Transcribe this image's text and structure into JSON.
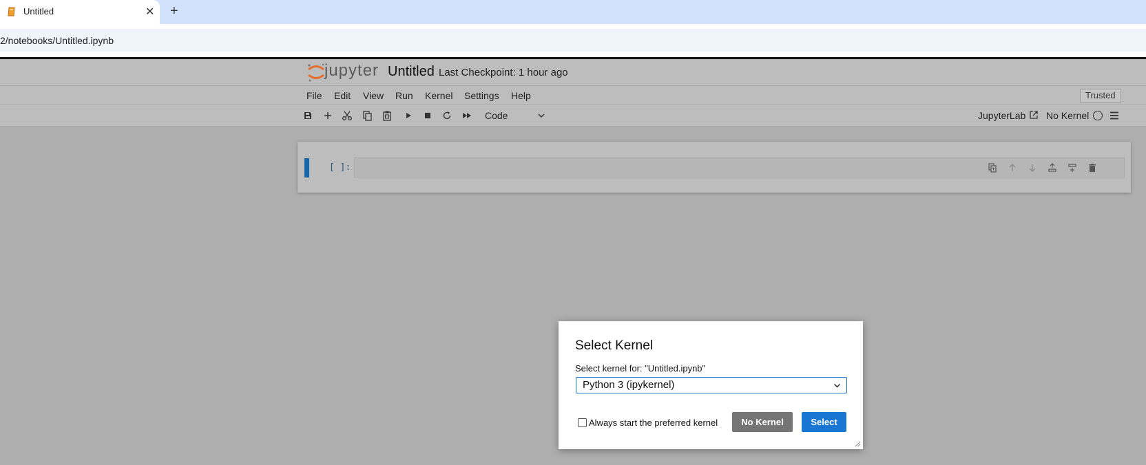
{
  "browser": {
    "tab_title": "Untitled",
    "tab_close": "✕",
    "new_tab": "+",
    "url": "2/notebooks/Untitled.ipynb"
  },
  "header": {
    "logo_text": "jupyter",
    "notebook_title": "Untitled",
    "checkpoint": "Last Checkpoint: 1 hour ago"
  },
  "menu": {
    "items": [
      "File",
      "Edit",
      "View",
      "Run",
      "Kernel",
      "Settings",
      "Help"
    ],
    "trusted": "Trusted"
  },
  "toolbar": {
    "icons": [
      "save-icon",
      "add-cell-icon",
      "cut-icon",
      "copy-icon",
      "paste-icon",
      "run-icon",
      "stop-icon",
      "restart-icon",
      "fast-forward-icon"
    ],
    "cell_type": "Code",
    "jupyterlab_link": "JupyterLab",
    "kernel_status": "No Kernel"
  },
  "cell": {
    "prompt": "[ ]:"
  },
  "dialog": {
    "title": "Select Kernel",
    "label": "Select kernel for: \"Untitled.ipynb\"",
    "selected_kernel": "Python 3 (ipykernel)",
    "checkbox_label": "Always start the preferred kernel",
    "checkbox_checked": false,
    "no_kernel_button": "No Kernel",
    "select_button": "Select"
  },
  "colors": {
    "accent": "#1976d2",
    "jupyter_orange": "#e46e2e",
    "secondary_button": "#757575"
  }
}
